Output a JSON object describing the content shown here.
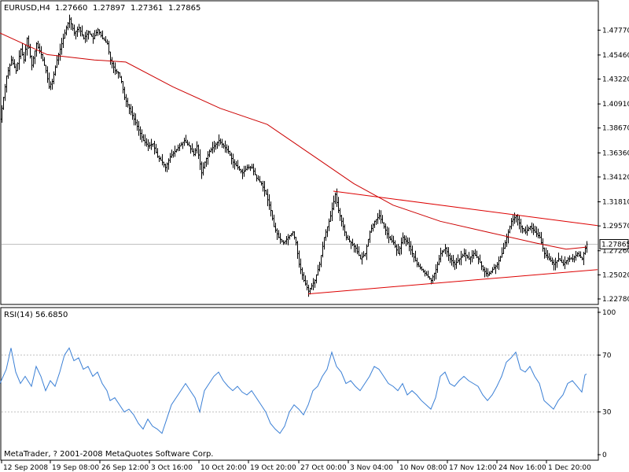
{
  "chart_data": [
    {
      "type": "bar",
      "subtype": "ohlc",
      "title": "EURUSD,H4",
      "ohlc_header": [
        "1.27660",
        "1.27897",
        "1.27361",
        "1.27865"
      ],
      "ylim": [
        1.2278,
        1.4911
      ],
      "y_ticks": [
        "1.47770",
        "1.45460",
        "1.43220",
        "1.40910",
        "1.38670",
        "1.36360",
        "1.34120",
        "1.31810",
        "1.29570",
        "1.27260",
        "1.25020",
        "1.22780"
      ],
      "current_price": "1.27865",
      "x_ticks": [
        "12 Sep 2008",
        "19 Sep 08:00",
        "26 Sep 12:00",
        "3 Oct 16:00",
        "10 Oct 20:00",
        "19 Oct 20:00",
        "27 Oct 00:00",
        "3 Nov 04:00",
        "10 Nov 08:00",
        "17 Nov 12:00",
        "24 Nov 16:00",
        "1 Dec 20:00"
      ],
      "price_path": [
        [
          0,
          1.395
        ],
        [
          4,
          1.415
        ],
        [
          8,
          1.435
        ],
        [
          14,
          1.45
        ],
        [
          20,
          1.44
        ],
        [
          26,
          1.46
        ],
        [
          30,
          1.45
        ],
        [
          34,
          1.47
        ],
        [
          40,
          1.445
        ],
        [
          46,
          1.465
        ],
        [
          52,
          1.455
        ],
        [
          58,
          1.44
        ],
        [
          62,
          1.425
        ],
        [
          66,
          1.43
        ],
        [
          72,
          1.45
        ],
        [
          78,
          1.465
        ],
        [
          84,
          1.48
        ],
        [
          88,
          1.488
        ],
        [
          94,
          1.475
        ],
        [
          100,
          1.48
        ],
        [
          106,
          1.47
        ],
        [
          112,
          1.476
        ],
        [
          118,
          1.47
        ],
        [
          124,
          1.478
        ],
        [
          130,
          1.47
        ],
        [
          136,
          1.465
        ],
        [
          140,
          1.45
        ],
        [
          146,
          1.44
        ],
        [
          150,
          1.438
        ],
        [
          154,
          1.43
        ],
        [
          158,
          1.415
        ],
        [
          164,
          1.405
        ],
        [
          170,
          1.395
        ],
        [
          176,
          1.385
        ],
        [
          182,
          1.375
        ],
        [
          188,
          1.37
        ],
        [
          194,
          1.372
        ],
        [
          200,
          1.36
        ],
        [
          206,
          1.355
        ],
        [
          210,
          1.35
        ],
        [
          216,
          1.36
        ],
        [
          222,
          1.365
        ],
        [
          228,
          1.37
        ],
        [
          234,
          1.375
        ],
        [
          240,
          1.37
        ],
        [
          246,
          1.362
        ],
        [
          250,
          1.37
        ],
        [
          256,
          1.345
        ],
        [
          260,
          1.355
        ],
        [
          266,
          1.365
        ],
        [
          272,
          1.37
        ],
        [
          278,
          1.375
        ],
        [
          284,
          1.37
        ],
        [
          290,
          1.365
        ],
        [
          296,
          1.355
        ],
        [
          302,
          1.35
        ],
        [
          308,
          1.345
        ],
        [
          314,
          1.35
        ],
        [
          320,
          1.35
        ],
        [
          326,
          1.34
        ],
        [
          332,
          1.335
        ],
        [
          338,
          1.325
        ],
        [
          344,
          1.31
        ],
        [
          348,
          1.295
        ],
        [
          354,
          1.285
        ],
        [
          360,
          1.28
        ],
        [
          366,
          1.285
        ],
        [
          372,
          1.29
        ],
        [
          376,
          1.28
        ],
        [
          380,
          1.26
        ],
        [
          386,
          1.245
        ],
        [
          392,
          1.235
        ],
        [
          396,
          1.24
        ],
        [
          400,
          1.245
        ],
        [
          406,
          1.26
        ],
        [
          412,
          1.285
        ],
        [
          416,
          1.295
        ],
        [
          420,
          1.305
        ],
        [
          426,
          1.325
        ],
        [
          430,
          1.31
        ],
        [
          434,
          1.3
        ],
        [
          440,
          1.285
        ],
        [
          446,
          1.28
        ],
        [
          452,
          1.275
        ],
        [
          458,
          1.265
        ],
        [
          464,
          1.27
        ],
        [
          470,
          1.29
        ],
        [
          476,
          1.3
        ],
        [
          482,
          1.305
        ],
        [
          488,
          1.295
        ],
        [
          494,
          1.285
        ],
        [
          500,
          1.28
        ],
        [
          506,
          1.27
        ],
        [
          512,
          1.285
        ],
        [
          518,
          1.28
        ],
        [
          524,
          1.27
        ],
        [
          530,
          1.26
        ],
        [
          536,
          1.255
        ],
        [
          542,
          1.25
        ],
        [
          548,
          1.245
        ],
        [
          554,
          1.255
        ],
        [
          560,
          1.27
        ],
        [
          566,
          1.275
        ],
        [
          572,
          1.265
        ],
        [
          578,
          1.26
        ],
        [
          584,
          1.265
        ],
        [
          590,
          1.27
        ],
        [
          596,
          1.265
        ],
        [
          602,
          1.27
        ],
        [
          608,
          1.265
        ],
        [
          614,
          1.255
        ],
        [
          620,
          1.25
        ],
        [
          626,
          1.255
        ],
        [
          632,
          1.26
        ],
        [
          638,
          1.27
        ],
        [
          644,
          1.285
        ],
        [
          650,
          1.3
        ],
        [
          656,
          1.305
        ],
        [
          662,
          1.295
        ],
        [
          668,
          1.29
        ],
        [
          674,
          1.295
        ],
        [
          680,
          1.29
        ],
        [
          686,
          1.285
        ],
        [
          692,
          1.27
        ],
        [
          698,
          1.265
        ],
        [
          704,
          1.26
        ],
        [
          710,
          1.265
        ],
        [
          716,
          1.26
        ],
        [
          722,
          1.265
        ],
        [
          728,
          1.265
        ],
        [
          734,
          1.27
        ],
        [
          740,
          1.265
        ],
        [
          744,
          1.275
        ],
        [
          746,
          1.2787
        ]
      ],
      "moving_average": [
        [
          0,
          1.475
        ],
        [
          60,
          1.455
        ],
        [
          120,
          1.45
        ],
        [
          160,
          1.448
        ],
        [
          220,
          1.425
        ],
        [
          280,
          1.405
        ],
        [
          340,
          1.39
        ],
        [
          400,
          1.36
        ],
        [
          450,
          1.335
        ],
        [
          500,
          1.315
        ],
        [
          560,
          1.3
        ],
        [
          620,
          1.29
        ],
        [
          680,
          1.28
        ],
        [
          720,
          1.274
        ],
        [
          746,
          1.276
        ]
      ],
      "trend_upper": [
        [
          424,
          1.328
        ],
        [
          760,
          1.296
        ]
      ],
      "trend_lower": [
        [
          392,
          1.2325
        ],
        [
          760,
          1.255
        ]
      ],
      "colors": {
        "price": "#000000",
        "moving_average": "#cc0000",
        "trend_lines": "#dd0000",
        "grid": "#c0c0c0"
      }
    },
    {
      "type": "line",
      "title": "RSI(14) 56.6850",
      "ylim": [
        0,
        100
      ],
      "y_ticks": [
        "100",
        "70",
        "30",
        "0"
      ],
      "levels": [
        70,
        30
      ],
      "values": [
        [
          0,
          50
        ],
        [
          8,
          60
        ],
        [
          14,
          75
        ],
        [
          20,
          58
        ],
        [
          26,
          50
        ],
        [
          32,
          55
        ],
        [
          40,
          48
        ],
        [
          46,
          62
        ],
        [
          52,
          55
        ],
        [
          58,
          45
        ],
        [
          64,
          52
        ],
        [
          70,
          48
        ],
        [
          76,
          58
        ],
        [
          82,
          70
        ],
        [
          88,
          75
        ],
        [
          94,
          66
        ],
        [
          100,
          68
        ],
        [
          106,
          60
        ],
        [
          112,
          62
        ],
        [
          118,
          55
        ],
        [
          124,
          58
        ],
        [
          130,
          50
        ],
        [
          136,
          45
        ],
        [
          140,
          38
        ],
        [
          146,
          40
        ],
        [
          152,
          35
        ],
        [
          158,
          30
        ],
        [
          164,
          32
        ],
        [
          170,
          28
        ],
        [
          176,
          22
        ],
        [
          182,
          18
        ],
        [
          188,
          25
        ],
        [
          194,
          20
        ],
        [
          200,
          18
        ],
        [
          206,
          15
        ],
        [
          212,
          25
        ],
        [
          218,
          35
        ],
        [
          224,
          40
        ],
        [
          230,
          45
        ],
        [
          236,
          50
        ],
        [
          242,
          45
        ],
        [
          248,
          40
        ],
        [
          254,
          30
        ],
        [
          260,
          45
        ],
        [
          266,
          50
        ],
        [
          272,
          55
        ],
        [
          278,
          58
        ],
        [
          284,
          52
        ],
        [
          290,
          48
        ],
        [
          296,
          45
        ],
        [
          302,
          48
        ],
        [
          308,
          44
        ],
        [
          314,
          42
        ],
        [
          320,
          45
        ],
        [
          326,
          40
        ],
        [
          332,
          35
        ],
        [
          338,
          30
        ],
        [
          344,
          22
        ],
        [
          350,
          18
        ],
        [
          356,
          15
        ],
        [
          362,
          20
        ],
        [
          368,
          30
        ],
        [
          374,
          35
        ],
        [
          380,
          32
        ],
        [
          386,
          28
        ],
        [
          392,
          35
        ],
        [
          398,
          45
        ],
        [
          404,
          48
        ],
        [
          410,
          55
        ],
        [
          416,
          60
        ],
        [
          422,
          72
        ],
        [
          428,
          62
        ],
        [
          434,
          58
        ],
        [
          440,
          50
        ],
        [
          446,
          52
        ],
        [
          452,
          48
        ],
        [
          458,
          45
        ],
        [
          464,
          50
        ],
        [
          470,
          55
        ],
        [
          476,
          62
        ],
        [
          482,
          60
        ],
        [
          488,
          55
        ],
        [
          494,
          50
        ],
        [
          500,
          48
        ],
        [
          506,
          45
        ],
        [
          512,
          50
        ],
        [
          518,
          42
        ],
        [
          524,
          45
        ],
        [
          530,
          42
        ],
        [
          536,
          38
        ],
        [
          542,
          35
        ],
        [
          548,
          32
        ],
        [
          554,
          40
        ],
        [
          560,
          55
        ],
        [
          566,
          58
        ],
        [
          572,
          50
        ],
        [
          578,
          48
        ],
        [
          584,
          52
        ],
        [
          590,
          55
        ],
        [
          596,
          52
        ],
        [
          602,
          50
        ],
        [
          608,
          48
        ],
        [
          614,
          42
        ],
        [
          620,
          38
        ],
        [
          626,
          42
        ],
        [
          632,
          48
        ],
        [
          638,
          55
        ],
        [
          644,
          65
        ],
        [
          650,
          68
        ],
        [
          656,
          72
        ],
        [
          662,
          60
        ],
        [
          668,
          58
        ],
        [
          674,
          62
        ],
        [
          680,
          55
        ],
        [
          686,
          50
        ],
        [
          692,
          38
        ],
        [
          698,
          35
        ],
        [
          704,
          32
        ],
        [
          710,
          38
        ],
        [
          716,
          42
        ],
        [
          722,
          50
        ],
        [
          728,
          52
        ],
        [
          734,
          48
        ],
        [
          740,
          44
        ],
        [
          744,
          56
        ],
        [
          746,
          56.685
        ]
      ],
      "colors": {
        "line": "#3a7fd5",
        "levels": "#c0c0c0"
      }
    }
  ],
  "footer": {
    "copyright": "MetaTrader, ? 2001-2008 MetaQuotes Software Corp."
  },
  "colors": {
    "background": "#ffffff",
    "axis": "#000000",
    "price_label_bg": "#ffffff"
  }
}
